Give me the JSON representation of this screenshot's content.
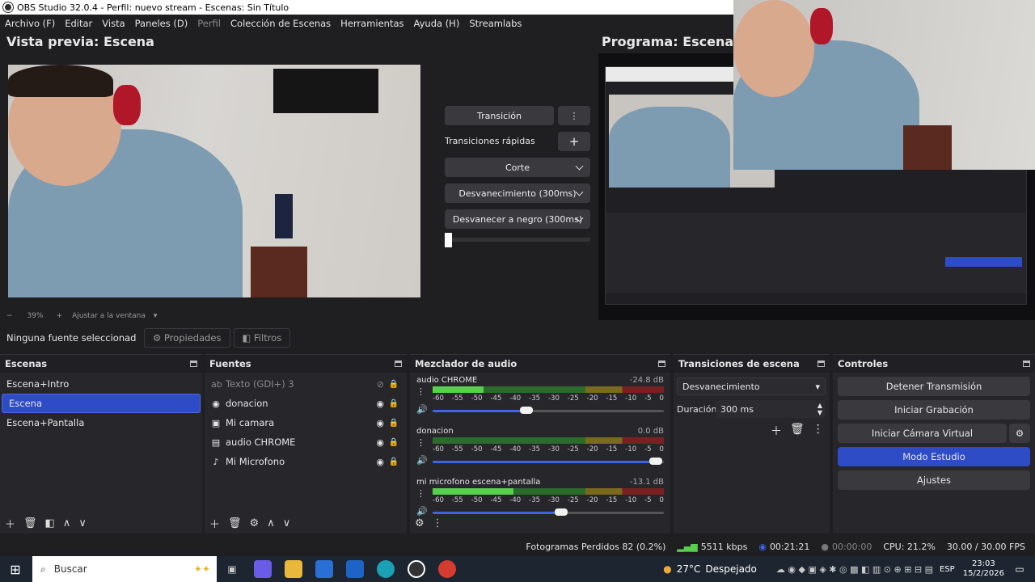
{
  "window": {
    "title": "OBS Studio 32.0.4 - Perfil: nuevo stream - Escenas: Sin Título"
  },
  "menu": [
    "Archivo (F)",
    "Editar",
    "Vista",
    "Paneles (D)",
    "Perfil",
    "Colección de Escenas",
    "Herramientas",
    "Ayuda (H)",
    "Streamlabs"
  ],
  "preview": {
    "title": "Vista previa: Escena",
    "zoom": "39%",
    "fit_label": "Ajustar a la ventana"
  },
  "program": {
    "title": "Programa: Escena+Pa"
  },
  "transition_panel": {
    "transition_button": "Transición",
    "quick_label": "Transiciones rápidas",
    "items": [
      "Corte",
      "Desvanecimiento (300ms)",
      "Desvanecer a negro (300ms)"
    ]
  },
  "source_toolbar": {
    "no_source": "Ninguna fuente seleccionad",
    "properties": "Propiedades",
    "filters": "Filtros"
  },
  "scenes": {
    "title": "Escenas",
    "items": [
      {
        "label": "Escena+Intro",
        "selected": false
      },
      {
        "label": "Escena",
        "selected": true
      },
      {
        "label": "Escena+Pantalla",
        "selected": false
      }
    ]
  },
  "sources": {
    "title": "Fuentes",
    "items": [
      {
        "label": "Texto (GDI+) 3",
        "icon": "text-icon",
        "visible": false
      },
      {
        "label": "donacion",
        "icon": "globe-icon",
        "visible": true
      },
      {
        "label": "Mi camara",
        "icon": "camera-icon",
        "visible": true
      },
      {
        "label": "audio CHROME",
        "icon": "window-capture-icon",
        "visible": true
      },
      {
        "label": "Mi Microfono",
        "icon": "microphone-icon",
        "visible": true
      }
    ]
  },
  "mixer": {
    "title": "Mezclador de audio",
    "scale": [
      "-60",
      "-55",
      "-50",
      "-45",
      "-40",
      "-35",
      "-30",
      "-25",
      "-20",
      "-15",
      "-10",
      "-5",
      "0"
    ],
    "channels": [
      {
        "name": "audio CHROME",
        "db": "-24.8 dB",
        "level": 0.22,
        "volume": 0.42
      },
      {
        "name": "donacion",
        "db": "0.0 dB",
        "level": 0.0,
        "volume": 0.98
      },
      {
        "name": "mi microfono escena+pantalla",
        "db": "-13.1 dB",
        "level": 0.35,
        "volume": 0.57
      }
    ]
  },
  "scene_transitions": {
    "title": "Transiciones de escena",
    "selected": "Desvanecimiento",
    "duration_label": "Duración",
    "duration_value": "300 ms"
  },
  "controls": {
    "title": "Controles",
    "buttons": [
      {
        "label": "Detener Transmisión",
        "active": false
      },
      {
        "label": "Iniciar Grabación",
        "active": false
      },
      {
        "label": "Iniciar Cámara Virtual",
        "active": false
      },
      {
        "label": "Modo Estudio",
        "active": true
      },
      {
        "label": "Ajustes",
        "active": false
      }
    ]
  },
  "status": {
    "dropped": "Fotogramas Perdidos 82 (0.2%)",
    "bitrate": "5511 kbps",
    "stream_time": "00:21:21",
    "rec_time": "00:00:00",
    "cpu": "CPU: 21.2%",
    "fps": "30.00 / 30.00 FPS"
  },
  "taskbar": {
    "search": "Buscar",
    "weather": "27°C",
    "weather_desc": "Despejado",
    "lang": "ESP",
    "time": "23:03",
    "date": "15/2/2026"
  },
  "colors": {
    "accent": "#2f4cc7",
    "meter_green": "#58d04e"
  }
}
